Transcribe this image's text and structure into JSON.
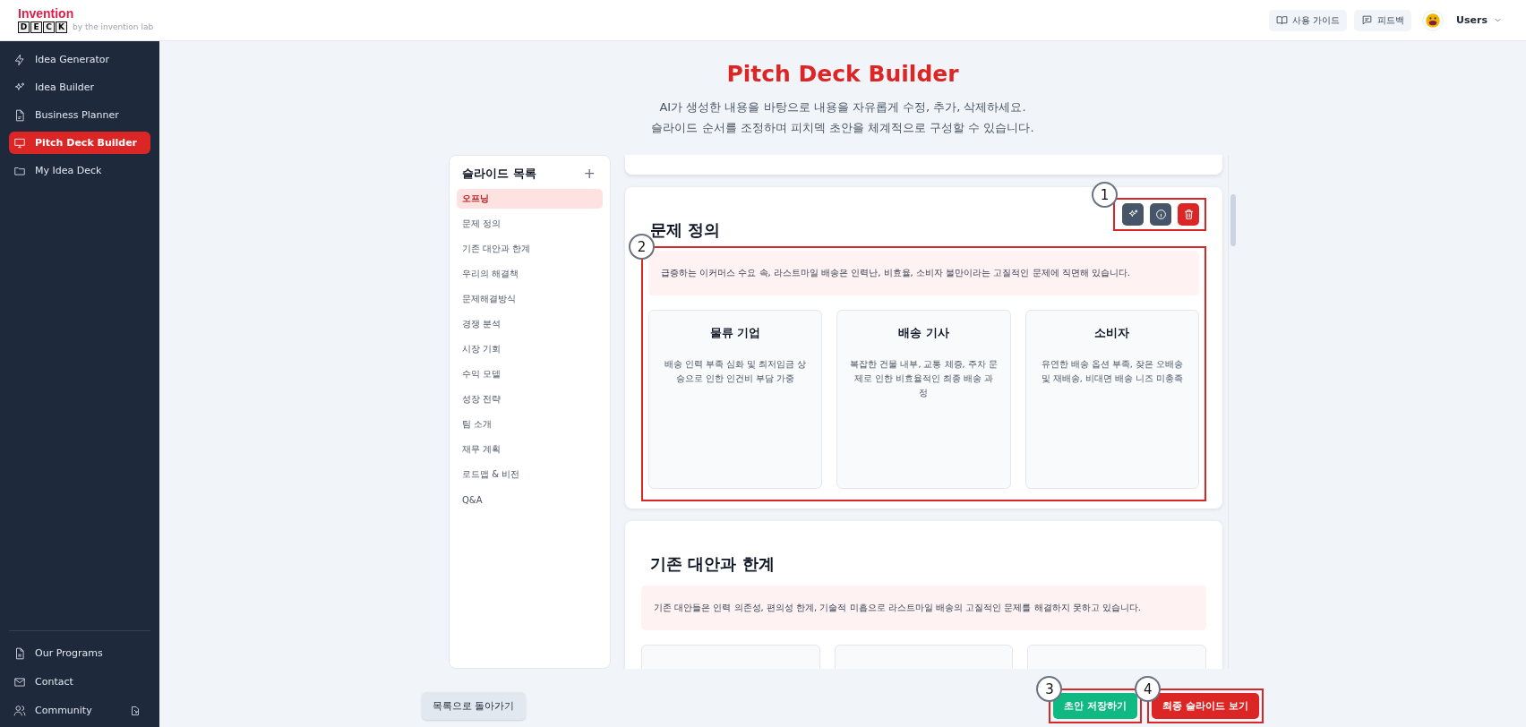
{
  "header": {
    "logo_word": "Invention",
    "logo_letters": [
      "D",
      "E",
      "C",
      "K"
    ],
    "logo_tagline": "by the invention lab",
    "guide_button": "사용 가이드",
    "feedback_button": "피드백",
    "user_name": "Users"
  },
  "sidebar": {
    "items": [
      {
        "label": "Idea Generator",
        "selected": false
      },
      {
        "label": "Idea Builder",
        "selected": false
      },
      {
        "label": "Business Planner",
        "selected": false
      },
      {
        "label": "Pitch Deck Builder",
        "selected": true
      },
      {
        "label": "My Idea Deck",
        "selected": false
      }
    ],
    "footer_items": [
      {
        "label": "Our Programs",
        "external": false
      },
      {
        "label": "Contact",
        "external": false
      },
      {
        "label": "Community",
        "external": true
      }
    ]
  },
  "page": {
    "title": "Pitch Deck Builder",
    "subtitle": [
      "AI가 생성한 내용을 바탕으로 내용을 자유롭게 수정, 추가, 삭제하세요.",
      "슬라이드 순서를 조정하며 피치덱 초안을 체계적으로 구성할 수 있습니다."
    ]
  },
  "slide_list": {
    "title": "슬라이드 목록",
    "add_icon": "+",
    "items": [
      {
        "label": "오프닝",
        "selected": true
      },
      {
        "label": "문제 정의",
        "selected": false
      },
      {
        "label": "기존 대안과 한계",
        "selected": false
      },
      {
        "label": "우리의 해결책",
        "selected": false
      },
      {
        "label": "문제해결방식",
        "selected": false
      },
      {
        "label": "경쟁 분석",
        "selected": false
      },
      {
        "label": "시장 기회",
        "selected": false
      },
      {
        "label": "수익 모델",
        "selected": false
      },
      {
        "label": "성장 전략",
        "selected": false
      },
      {
        "label": "팀 소개",
        "selected": false
      },
      {
        "label": "재무 계획",
        "selected": false
      },
      {
        "label": "로드맵 & 비전",
        "selected": false
      },
      {
        "label": "Q&A",
        "selected": false
      }
    ]
  },
  "slides": [
    {
      "title": "문제 정의",
      "summary": "급증하는 이커머스 수요 속, 라스트마일 배송은 인력난, 비효율, 소비자 불만이라는 고질적인 문제에 직면해 있습니다.",
      "cards": [
        {
          "title": "물류 기업",
          "text": "배송 인력 부족 심화 및 최저임금 상승으로 인한 인건비 부담 가중"
        },
        {
          "title": "배송 기사",
          "text": "복잡한 건물 내부, 교통 체증, 주차 문제로 인한 비효율적인 최종 배송 과정"
        },
        {
          "title": "소비자",
          "text": "유연한 배송 옵션 부족, 잦은 오배송 및 재배송, 비대면 배송 니즈 미충족"
        }
      ]
    },
    {
      "title": "기존 대안과 한계",
      "summary": "기존 대안들은 인력 의존성, 편의성 한계, 기술적 미흡으로 라스트마일 배송의 고질적인 문제를 해결하지 못하고 있습니다."
    }
  ],
  "buttons": {
    "back": "목록으로 돌아가기",
    "save": "초안 저장하기",
    "final": "최종 슬라이드 보기"
  },
  "callouts": [
    "1",
    "2",
    "3",
    "4"
  ]
}
